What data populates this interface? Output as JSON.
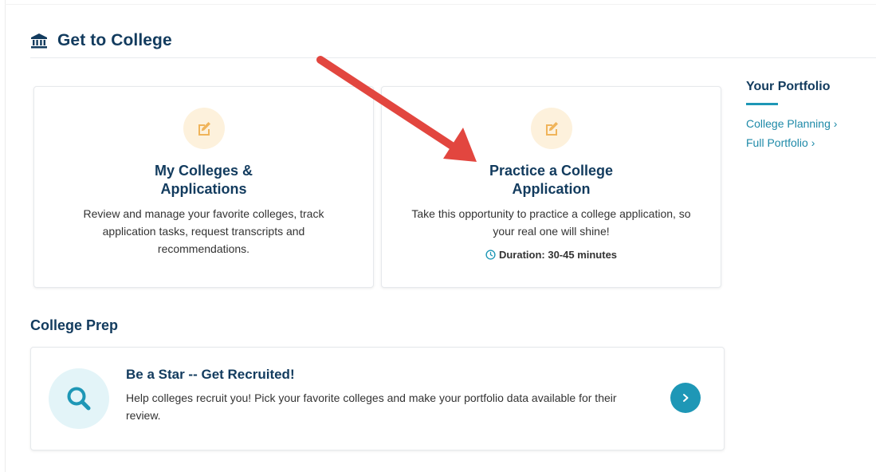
{
  "header": {
    "title": "Get to College",
    "icon": "bank-icon"
  },
  "cards": [
    {
      "icon": "edit-icon",
      "title_line1": "My Colleges &",
      "title_line2": "Applications",
      "description": "Review and manage your favorite colleges, track application tasks, request transcripts and recommendations."
    },
    {
      "icon": "edit-icon",
      "title_line1": "Practice a College",
      "title_line2": "Application",
      "description": "Take this opportunity to practice a college application, so your real one will shine!",
      "duration": "Duration: 30-45 minutes"
    }
  ],
  "portfolio": {
    "title": "Your Portfolio",
    "links": [
      {
        "label": "College Planning ›"
      },
      {
        "label": "Full Portfolio ›"
      }
    ]
  },
  "college_prep": {
    "title": "College Prep",
    "item": {
      "icon": "search-icon",
      "title": "Be a Star -- Get Recruited!",
      "description": "Help colleges recruit you! Pick your favorite colleges and make your portfolio data available for their review."
    }
  },
  "colors": {
    "navy": "#123b5e",
    "teal": "#1e97b6",
    "link": "#1e8aa8",
    "icon_bg": "#fdf1dc",
    "icon_orange": "#f0b45a",
    "arrow_red": "#e2463f"
  }
}
